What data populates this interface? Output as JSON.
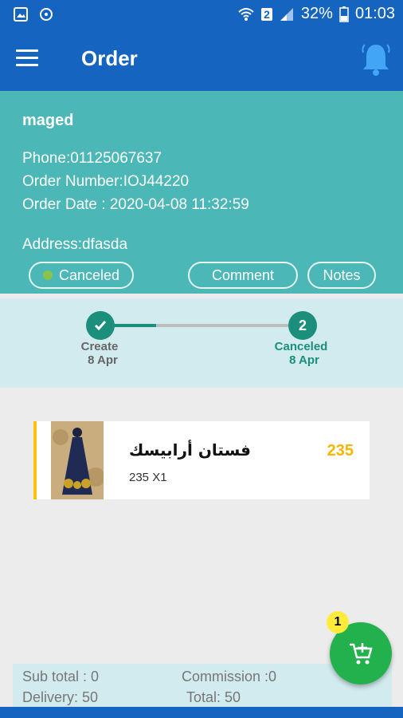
{
  "status_bar": {
    "battery": "32%",
    "time": "01:03",
    "sim": "2"
  },
  "app_bar": {
    "title": "Order",
    "menu_icon": "hamburger-menu-icon",
    "bell_icon": "bell-icon"
  },
  "order": {
    "customer_name": "maged",
    "phone": "Phone:01125067637",
    "order_number": "Order Number:IOJ44220",
    "order_date": "Order Date : 2020-04-08 11:32:59",
    "address": "Address:dfasda",
    "status_label": "Canceled",
    "comment_label": "Comment",
    "notes_label": "Notes"
  },
  "progress": {
    "steps": [
      {
        "marker": "",
        "label": "Create",
        "date": "8 Apr"
      },
      {
        "marker": "2",
        "label": "Canceled",
        "date": "8 Apr"
      }
    ]
  },
  "items": [
    {
      "name": "فستان أرابيسك",
      "qty": "235   X1",
      "price": "235"
    }
  ],
  "cart": {
    "badge_count": "1"
  },
  "totals": {
    "sub_total": "Sub total : 0",
    "commission": "Commission :0",
    "delivery": "Delivery: 50",
    "total": "Total: 50"
  },
  "colors": {
    "primary": "#1565c0",
    "header_teal": "#4bb7b7",
    "progress_bg": "#d2ebee",
    "step_green": "#1b8f7c",
    "price_yellow": "#f6b600",
    "fab_green": "#22b14c"
  }
}
